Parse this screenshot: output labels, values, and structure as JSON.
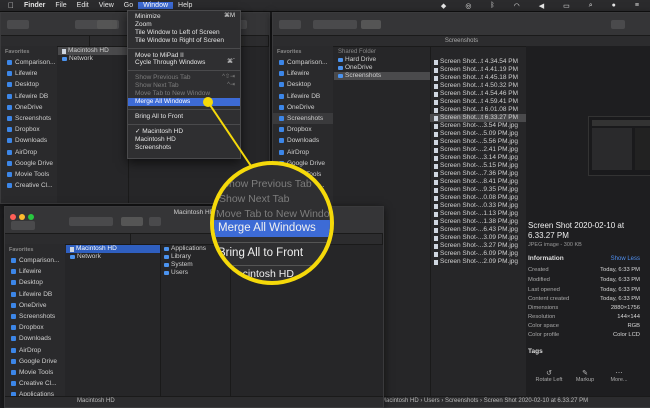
{
  "menubar": {
    "apple": "",
    "finder": "Finder",
    "file": "File",
    "edit": "Edit",
    "view": "View",
    "go": "Go",
    "window": "Window",
    "help": "Help"
  },
  "window_menu": [
    {
      "label": "Minimize",
      "shortcut": "⌘M",
      "state": "normal"
    },
    {
      "label": "Zoom",
      "shortcut": "",
      "state": "normal"
    },
    {
      "label": "Tile Window to Left of Screen",
      "shortcut": "",
      "state": "normal"
    },
    {
      "label": "Tile Window to Right of Screen",
      "shortcut": "",
      "state": "normal"
    },
    {
      "sep": true
    },
    {
      "label": "Move to MiPad II",
      "shortcut": "",
      "state": "normal"
    },
    {
      "label": "Cycle Through Windows",
      "shortcut": "⌘`",
      "state": "normal"
    },
    {
      "sep": true
    },
    {
      "label": "Show Previous Tab",
      "shortcut": "^⇧⇥",
      "state": "disabled"
    },
    {
      "label": "Show Next Tab",
      "shortcut": "^⇥",
      "state": "disabled"
    },
    {
      "label": "Move Tab to New Window",
      "shortcut": "",
      "state": "disabled"
    },
    {
      "label": "Merge All Windows",
      "shortcut": "",
      "state": "highlighted"
    },
    {
      "sep": true
    },
    {
      "label": "Bring All to Front",
      "shortcut": "",
      "state": "normal"
    },
    {
      "sep": true
    },
    {
      "label": "✓ Macintosh HD",
      "shortcut": "",
      "state": "normal"
    },
    {
      "label": "Macintosh HD",
      "shortcut": "",
      "state": "normal"
    },
    {
      "label": "Screenshots",
      "shortcut": "",
      "state": "normal"
    }
  ],
  "magnifier": {
    "l1": "Show Previous Tab",
    "l2": "Show Next Tab",
    "l3": "Move Tab to New Window",
    "l4": "Merge All Windows",
    "l5": "Bring All to Front",
    "l6": "Macintosh HD"
  },
  "sidebar": {
    "favorites": "Favorites",
    "items": [
      "Comparison...",
      "Lifewire",
      "Desktop",
      "Lifewire DB",
      "OneDrive",
      "Screenshots",
      "Dropbox",
      "Downloads",
      "AirDrop",
      "Google Drive",
      "Movie Tools",
      "Creative Cl...",
      "Applications"
    ]
  },
  "top_left_window": {
    "col1": [
      "Macintosh HD",
      "Network"
    ]
  },
  "right_window": {
    "title": "Screenshots",
    "shared_header": "Shared Folder",
    "col1": [
      "Hard Drive",
      "OneDrive",
      "Screenshots"
    ],
    "files": [
      "Screen Shot...t 4.34.54 PM",
      "Screen Shot...t 4.41.19 PM",
      "Screen Shot...t 4.45.18 PM",
      "Screen Shot...t 4.50.32 PM",
      "Screen Shot...t 4.54.46 PM",
      "Screen Shot...t 4.59.41 PM",
      "Screen Shot...t 6.01.08 PM",
      "Screen Shot...t 6.33.27 PM",
      "Screen Shot-...3.54 PM.jpg",
      "Screen Shot-...5.09 PM.jpg",
      "Screen Shot-...5.56 PM.jpg",
      "Screen Shot-...2.41 PM.jpg",
      "Screen Shot-...3.14 PM.jpg",
      "Screen Shot-...5.15 PM.jpg",
      "Screen Shot-...7.36 PM.jpg",
      "Screen Shot-...8.41 PM.jpg",
      "Screen Shot-...9.35 PM.jpg",
      "Screen Shot-...0.08 PM.jpg",
      "Screen Shot-...0.33 PM.jpg",
      "Screen Shot-...1.13 PM.jpg",
      "Screen Shot-...1.38 PM.jpg",
      "Screen Shot-...6.43 PM.jpg",
      "Screen Shot-...3.09 PM.jpg",
      "Screen Shot-...3.27 PM.jpg",
      "Screen Shot-...6.09 PM.jpg",
      "Screen Shot-...2.09 PM.jpg"
    ],
    "preview_title": "Screen Shot 2020-02-10 at 6.33.27 PM",
    "preview_sub": "JPEG image - 300 KB",
    "info": "Information",
    "show_less": "Show Less",
    "meta": [
      {
        "k": "Created",
        "v": "Today, 6:33 PM"
      },
      {
        "k": "Modified",
        "v": "Today, 6:33 PM"
      },
      {
        "k": "Last opened",
        "v": "Today, 6:33 PM"
      },
      {
        "k": "Content created",
        "v": "Today, 6:33 PM"
      },
      {
        "k": "Dimensions",
        "v": "2880×1756"
      },
      {
        "k": "Resolution",
        "v": "144×144"
      },
      {
        "k": "Color space",
        "v": "RGB"
      },
      {
        "k": "Color profile",
        "v": "Color LCD"
      }
    ],
    "tags": "Tags",
    "actions": [
      "Rotate Left",
      "Markup",
      "More..."
    ],
    "path": "Macintosh HD › Users › Screenshots › Screen Shot 2020-02-10 at 6.33.27 PM"
  },
  "bottom_window": {
    "title": "Macintosh HD",
    "col1": [
      "Macintosh HD",
      "Network"
    ],
    "col2": [
      "Applications",
      "Library",
      "System",
      "Users"
    ],
    "path": "Macintosh HD"
  }
}
